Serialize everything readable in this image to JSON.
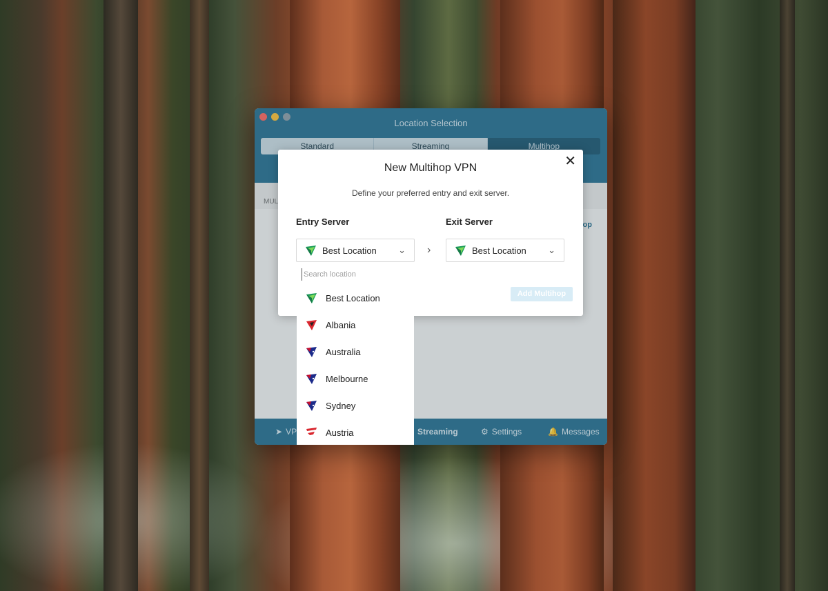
{
  "window": {
    "title": "Location Selection",
    "tabs": [
      "Standard",
      "Streaming",
      "Multihop"
    ],
    "active_tab": "Multihop",
    "bg_hint_left": "MUL",
    "bg_hint_right": "op"
  },
  "bottom_nav": {
    "items": [
      {
        "label": "VP",
        "icon": "vpn-icon"
      },
      {
        "label": "Streaming",
        "icon": "play-icon"
      },
      {
        "label": "Settings",
        "icon": "gear-icon"
      },
      {
        "label": "Messages",
        "icon": "bell-icon"
      }
    ]
  },
  "modal": {
    "title": "New Multihop VPN",
    "subtitle": "Define your preferred entry and exit server.",
    "entry_label": "Entry Server",
    "exit_label": "Exit Server",
    "entry_value": "Best Location",
    "exit_value": "Best Location",
    "search_placeholder": "Search location",
    "add_button": "Add Multihop"
  },
  "dropdown": {
    "items": [
      {
        "label": "Best Location",
        "flag": "best"
      },
      {
        "label": "Albania",
        "flag": "albania"
      },
      {
        "label": "Australia",
        "flag": "australia"
      },
      {
        "label": "Melbourne",
        "flag": "australia"
      },
      {
        "label": "Sydney",
        "flag": "australia"
      },
      {
        "label": "Austria",
        "flag": "austria"
      }
    ]
  },
  "colors": {
    "window_header": "#1f6a8c",
    "tab_active": "#15506d",
    "add_button_disabled": "#d8ecf6"
  }
}
